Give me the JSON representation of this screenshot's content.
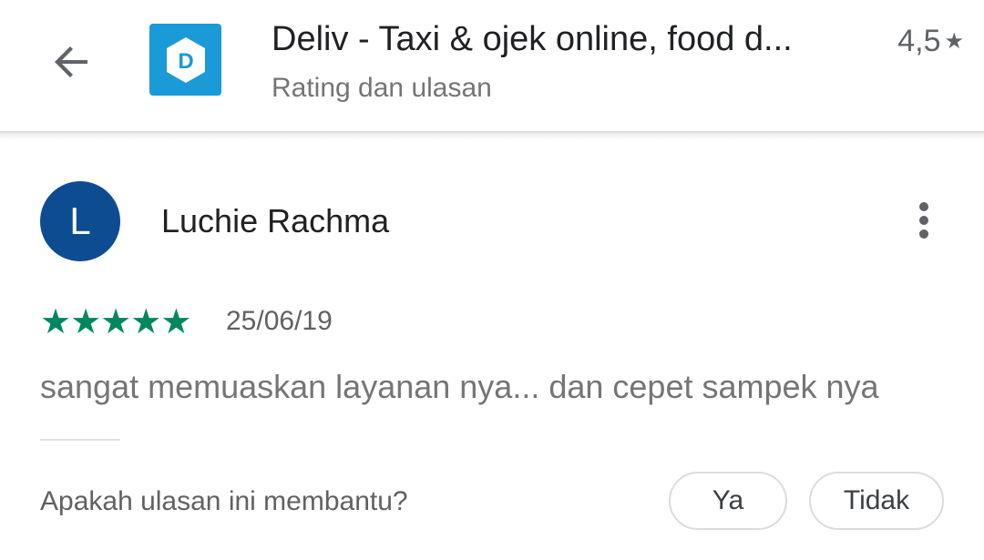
{
  "header": {
    "back_icon": "arrow-left-icon",
    "app_icon": "deliv-logo",
    "app_icon_letter": "D",
    "app_title": "Deliv - Taxi & ojek online, food d...",
    "rating": "4,5",
    "rating_star": "★",
    "subtitle": "Rating dan ulasan"
  },
  "review": {
    "avatar_letter": "L",
    "avatar_color": "#0e4c92",
    "reviewer_name": "Luchie Rachma",
    "more_icon": "more-vertical-icon",
    "star_rating": 5,
    "star_color": "#01875f",
    "date": "25/06/19",
    "text": "sangat memuaskan layanan nya... dan cepet sampek nya"
  },
  "helpful": {
    "question": "Apakah ulasan ini membantu?",
    "yes_label": "Ya",
    "no_label": "Tidak"
  },
  "colors": {
    "accent": "#1a9ad6",
    "green": "#01875f"
  }
}
